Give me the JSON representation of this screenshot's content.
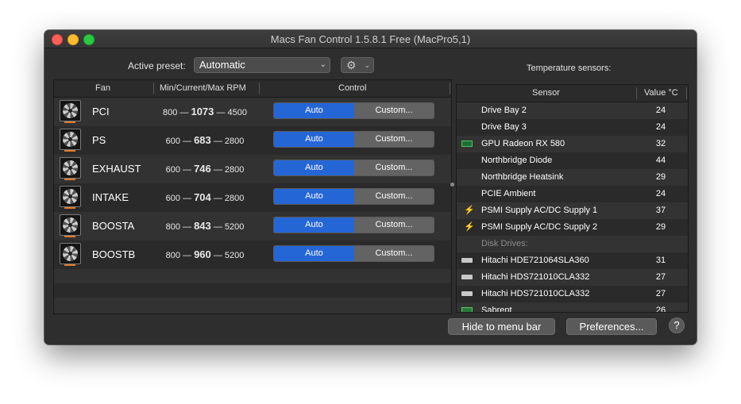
{
  "window": {
    "title": "Macs Fan Control 1.5.8.1 Free (MacPro5,1)"
  },
  "toolbar": {
    "active_preset_label": "Active preset:",
    "preset_value": "Automatic",
    "chevron_glyph": "⌄",
    "gear_glyph": "⚙"
  },
  "fan_table": {
    "headers": {
      "fan": "Fan",
      "rpm": "Min/Current/Max RPM",
      "control": "Control"
    },
    "separator": "—",
    "auto_label": "Auto",
    "custom_label": "Custom...",
    "rows": [
      {
        "name": "PCI",
        "min": "800",
        "current": "1073",
        "max": "4500"
      },
      {
        "name": "PS",
        "min": "600",
        "current": "683",
        "max": "2800"
      },
      {
        "name": "EXHAUST",
        "min": "600",
        "current": "746",
        "max": "2800"
      },
      {
        "name": "INTAKE",
        "min": "600",
        "current": "704",
        "max": "2800"
      },
      {
        "name": "BOOSTA",
        "min": "800",
        "current": "843",
        "max": "5200"
      },
      {
        "name": "BOOSTB",
        "min": "800",
        "current": "960",
        "max": "5200"
      }
    ]
  },
  "sensors": {
    "title": "Temperature sensors:",
    "headers": {
      "sensor": "Sensor",
      "value": "Value °C"
    },
    "bolt_glyph": "⚡",
    "rows": [
      {
        "name": "Drive Bay 2",
        "value": "24",
        "icon": ""
      },
      {
        "name": "Drive Bay 3",
        "value": "24",
        "icon": ""
      },
      {
        "name": "GPU Radeon RX 580",
        "value": "32",
        "icon": "gpu-icon"
      },
      {
        "name": "Northbridge Diode",
        "value": "44",
        "icon": ""
      },
      {
        "name": "Northbridge Heatsink",
        "value": "29",
        "icon": ""
      },
      {
        "name": "PCIE Ambient",
        "value": "24",
        "icon": ""
      },
      {
        "name": "PSMI Supply AC/DC Supply 1",
        "value": "37",
        "icon": "lightning-icon"
      },
      {
        "name": "PSMI Supply AC/DC Supply 2",
        "value": "29",
        "icon": "lightning-icon"
      }
    ],
    "disk_category": "Disk Drives:",
    "disks": [
      {
        "name": "Hitachi HDE721064SLA360",
        "value": "31",
        "icon": "disk-icon"
      },
      {
        "name": "Hitachi HDS721010CLA332",
        "value": "27",
        "icon": "disk-icon"
      },
      {
        "name": "Hitachi HDS721010CLA332",
        "value": "27",
        "icon": "disk-icon"
      },
      {
        "name": "Sabrent",
        "value": "26",
        "icon": "ssd-icon"
      }
    ]
  },
  "footer": {
    "hide_label": "Hide to menu bar",
    "preferences_label": "Preferences...",
    "help_label": "?"
  },
  "colors": {
    "window_bg": "#2e2e2e",
    "auto_button": "#2566d6",
    "custom_button": "#636363",
    "close": "#fe5f57",
    "minimize": "#febc2e",
    "zoom": "#28c840"
  }
}
